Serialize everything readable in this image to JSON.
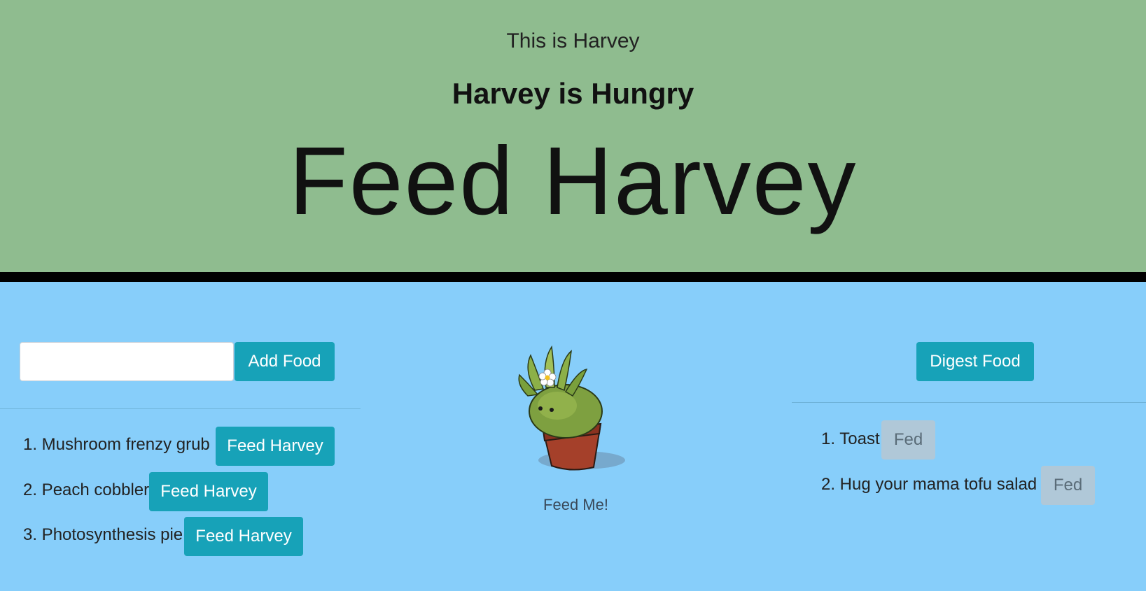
{
  "header": {
    "subtitle": "This is Harvey",
    "status": "Harvey is Hungry",
    "title": "Feed Harvey"
  },
  "left": {
    "input_value": "",
    "add_label": "Add Food",
    "items": [
      {
        "text": "1. Mushroom frenzy grub",
        "button": "Feed Harvey"
      },
      {
        "text": "2. Peach cobbler",
        "button": "Feed Harvey"
      },
      {
        "text": "3. Photosynthesis pie",
        "button": "Feed Harvey"
      }
    ]
  },
  "center": {
    "caption": "Feed Me!"
  },
  "right": {
    "digest_label": "Digest Food",
    "items": [
      {
        "text": "1. Toast",
        "button": "Fed"
      },
      {
        "text": "2. Hug your mama tofu salad",
        "button": "Fed"
      }
    ]
  },
  "colors": {
    "header_bg": "#8fbc8f",
    "body_bg": "#87cefa",
    "button": "#17a2b8",
    "button_disabled": "#b0c8d8"
  }
}
